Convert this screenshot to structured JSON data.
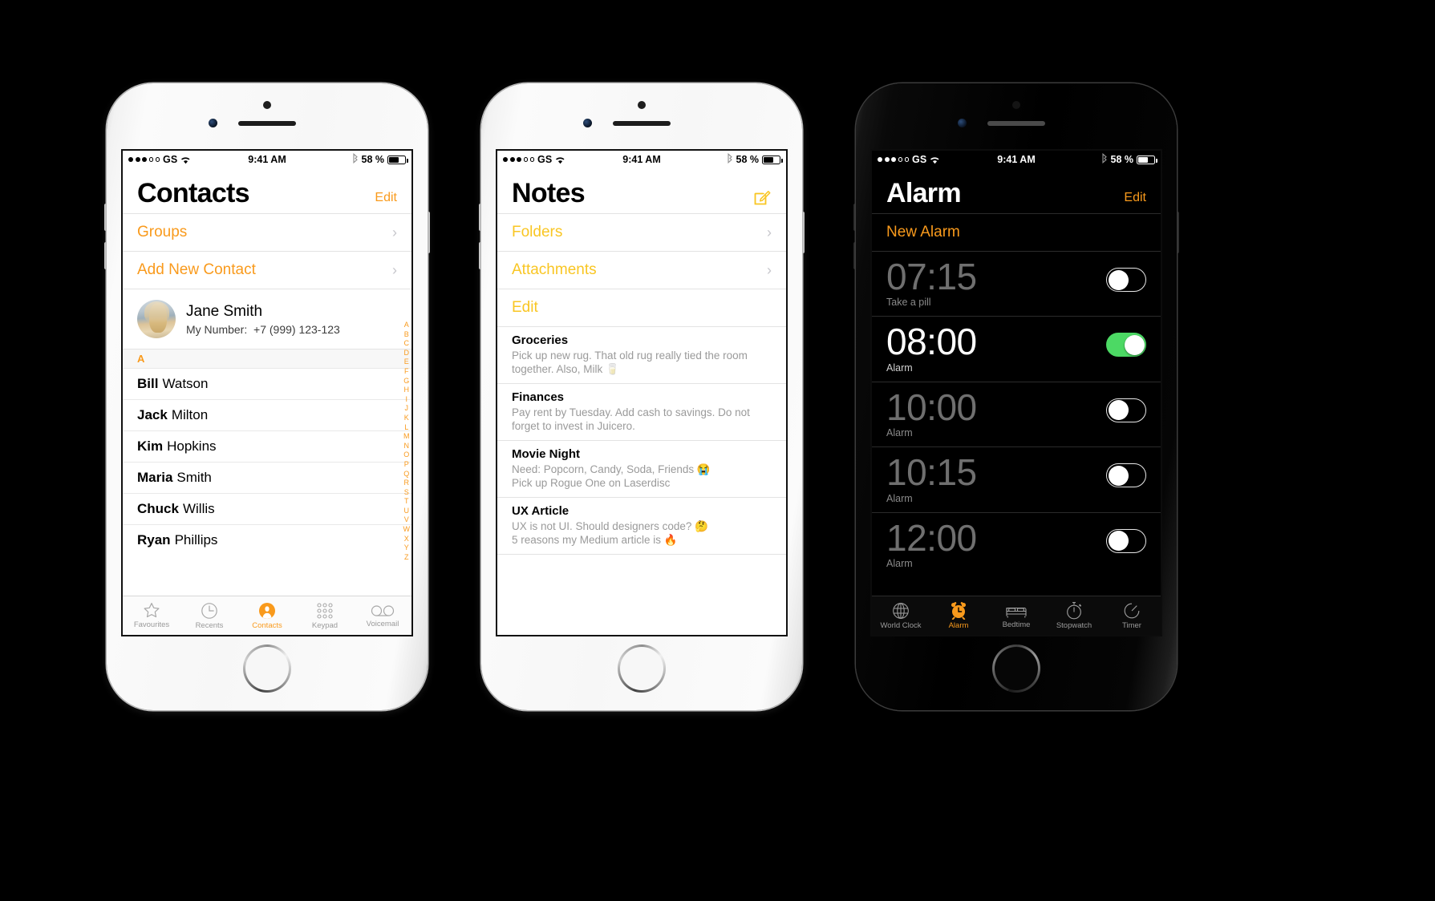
{
  "colors": {
    "ios_orange": "#f99a1c",
    "notes_yellow": "#f9c623",
    "toggle_green": "#4cd964",
    "light_screen_bg": "#ffffff",
    "dark_screen_bg": "#000000",
    "secondary_text": "#9a9a9a"
  },
  "status_bar": {
    "carrier": "GS",
    "signal_filled_dots": 3,
    "signal_empty_dots": 2,
    "wifi": "wifi-icon",
    "time": "9:41 AM",
    "bluetooth": "bluetooth-icon",
    "battery_percent": "58 %",
    "battery_level": 58
  },
  "phones": [
    {
      "id": "contacts",
      "frame": "white",
      "app": "Contacts",
      "nav": {
        "title": "Contacts",
        "action_label": "Edit"
      },
      "menu_rows": [
        {
          "label": "Groups",
          "chevron": "chevron-right-icon"
        },
        {
          "label": "Add New Contact",
          "chevron": "chevron-right-icon"
        }
      ],
      "me_card": {
        "avatar": "user-photo-avatar",
        "name": "Jane Smith",
        "number_label": "My Number:",
        "number_value": "+7 (999) 123-123"
      },
      "section_header": "A",
      "contacts": [
        {
          "first": "Bill",
          "last": "Watson"
        },
        {
          "first": "Jack",
          "last": "Milton"
        },
        {
          "first": "Kim",
          "last": "Hopkins"
        },
        {
          "first": "Maria",
          "last": "Smith"
        },
        {
          "first": "Chuck",
          "last": "Willis"
        },
        {
          "first": "Ryan",
          "last": "Phillips"
        }
      ],
      "alpha_index": [
        "A",
        "B",
        "C",
        "D",
        "E",
        "F",
        "G",
        "H",
        "I",
        "J",
        "K",
        "L",
        "M",
        "N",
        "O",
        "P",
        "Q",
        "R",
        "S",
        "T",
        "U",
        "V",
        "W",
        "X",
        "Y",
        "Z"
      ],
      "tabs": [
        {
          "label": "Favourites",
          "icon": "star-icon",
          "active": false
        },
        {
          "label": "Recents",
          "icon": "clock-icon",
          "active": false
        },
        {
          "label": "Contacts",
          "icon": "contact-icon",
          "active": true
        },
        {
          "label": "Keypad",
          "icon": "keypad-icon",
          "active": false
        },
        {
          "label": "Voicemail",
          "icon": "voicemail-icon",
          "active": false
        }
      ]
    },
    {
      "id": "notes",
      "frame": "white",
      "app": "Notes",
      "nav": {
        "title": "Notes",
        "action_icon": "compose-icon"
      },
      "menu_rows": [
        {
          "label": "Folders",
          "chevron": "chevron-right-icon"
        },
        {
          "label": "Attachments",
          "chevron": "chevron-right-icon"
        },
        {
          "label": "Edit",
          "chevron": ""
        }
      ],
      "notes": [
        {
          "title": "Groceries",
          "body": "Pick up new rug. That old rug really tied the room together. Also, Milk 🥛"
        },
        {
          "title": "Finances",
          "body": "Pay rent by Tuesday. Add cash to savings. Do not forget to invest in Juicero."
        },
        {
          "title": "Movie Night",
          "body": "Need: Popcorn, Candy, Soda, Friends 😭\nPick up Rogue One on Laserdisc"
        },
        {
          "title": "UX Article",
          "body": "UX is not UI. Should designers code? 🤔\n5 reasons my Medium article is 🔥"
        }
      ]
    },
    {
      "id": "alarm",
      "frame": "black",
      "app": "Alarm",
      "nav": {
        "title": "Alarm",
        "action_label": "Edit"
      },
      "menu_rows": [
        {
          "label": "New Alarm",
          "chevron": ""
        }
      ],
      "alarms": [
        {
          "time": "07:15",
          "label": "Take a pill",
          "enabled": false
        },
        {
          "time": "08:00",
          "label": "Alarm",
          "enabled": true
        },
        {
          "time": "10:00",
          "label": "Alarm",
          "enabled": false
        },
        {
          "time": "10:15",
          "label": "Alarm",
          "enabled": false
        },
        {
          "time": "12:00",
          "label": "Alarm",
          "enabled": false
        }
      ],
      "tabs": [
        {
          "label": "World Clock",
          "icon": "globe-icon",
          "active": false
        },
        {
          "label": "Alarm",
          "icon": "alarm-icon",
          "active": true
        },
        {
          "label": "Bedtime",
          "icon": "bed-icon",
          "active": false
        },
        {
          "label": "Stopwatch",
          "icon": "stopwatch-icon",
          "active": false
        },
        {
          "label": "Timer",
          "icon": "timer-icon",
          "active": false
        }
      ]
    }
  ]
}
